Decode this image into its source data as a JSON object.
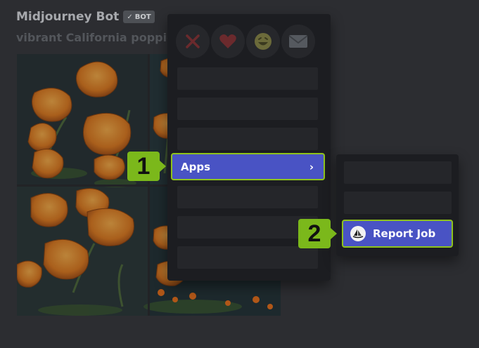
{
  "message": {
    "author": "Midjourney Bot",
    "badge_check": "✓",
    "badge_label": "BOT",
    "prompt_preview": "vibrant California poppies"
  },
  "context_menu": {
    "reactions": [
      {
        "icon": "x-icon"
      },
      {
        "icon": "heart-icon"
      },
      {
        "icon": "grin-emoji-icon"
      },
      {
        "icon": "envelope-icon"
      }
    ],
    "apps_label": "Apps",
    "apps_chevron": "›"
  },
  "submenu": {
    "report_label": "Report Job",
    "report_icon": "midjourney-sailboat-icon"
  },
  "callouts": {
    "step1": "1",
    "step2": "2"
  },
  "colors": {
    "highlight": "#4953c4",
    "callout": "#7bb81b",
    "outline": "#8ec31c",
    "menu_bg": "#1c1d21"
  }
}
